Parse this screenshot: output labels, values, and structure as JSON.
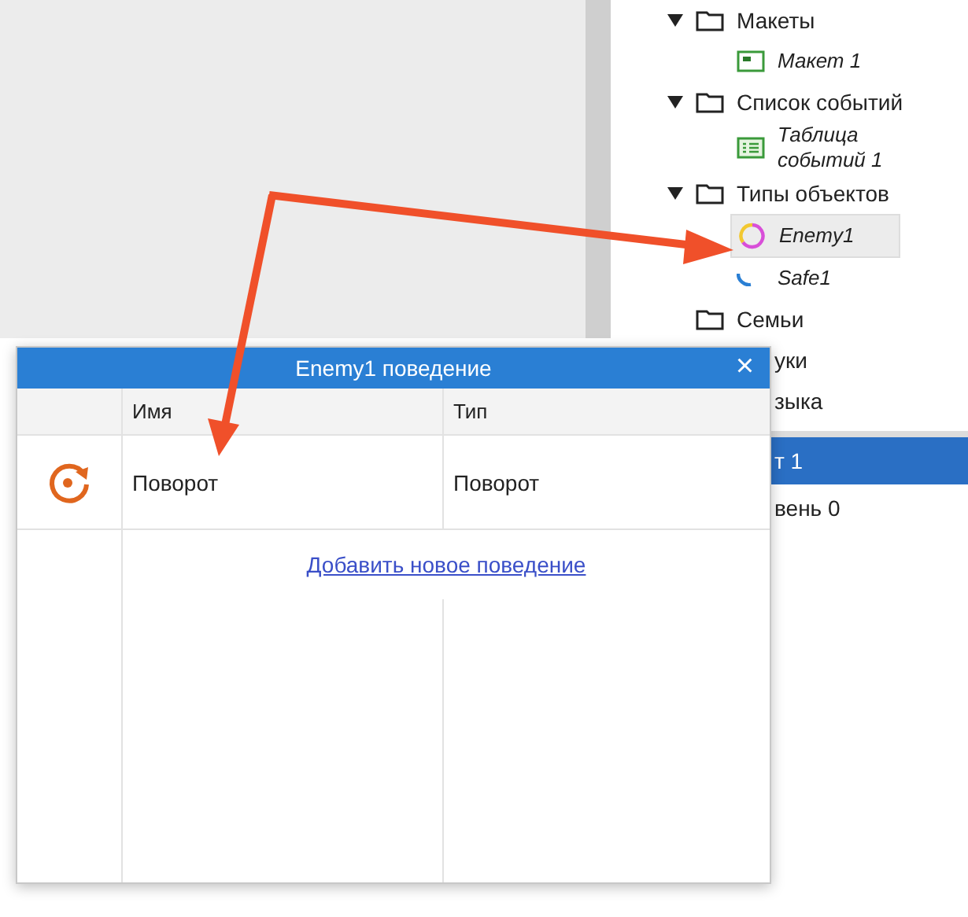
{
  "project_tree": [
    {
      "kind": "folder",
      "label": "Макеты",
      "expanded": true,
      "children": [
        {
          "kind": "layout",
          "label": "Макет 1",
          "selected": false
        }
      ]
    },
    {
      "kind": "folder",
      "label": "Список событий",
      "expanded": true,
      "children": [
        {
          "kind": "eventsheet",
          "label": "Таблица событий 1",
          "selected": false
        }
      ]
    },
    {
      "kind": "folder",
      "label": "Типы объектов",
      "expanded": true,
      "children": [
        {
          "kind": "sprite",
          "label": "Enemy1",
          "selected": true
        },
        {
          "kind": "sprite2",
          "label": "Safe1",
          "selected": false
        }
      ]
    },
    {
      "kind": "folder",
      "label": "Семьи"
    },
    {
      "kind": "cut",
      "label": "уки"
    },
    {
      "kind": "cut",
      "label": "зыка"
    }
  ],
  "layers": [
    {
      "label": "т 1",
      "selected": true
    },
    {
      "label": "вень 0",
      "selected": false
    }
  ],
  "dialog": {
    "title": "Enemy1 поведение",
    "close": "×",
    "columns": [
      "Имя",
      "Тип"
    ],
    "rows": [
      {
        "kind": "rotate",
        "name": "Поворот",
        "type": "Поворот"
      }
    ],
    "add_link": "Добавить новое поведение"
  }
}
